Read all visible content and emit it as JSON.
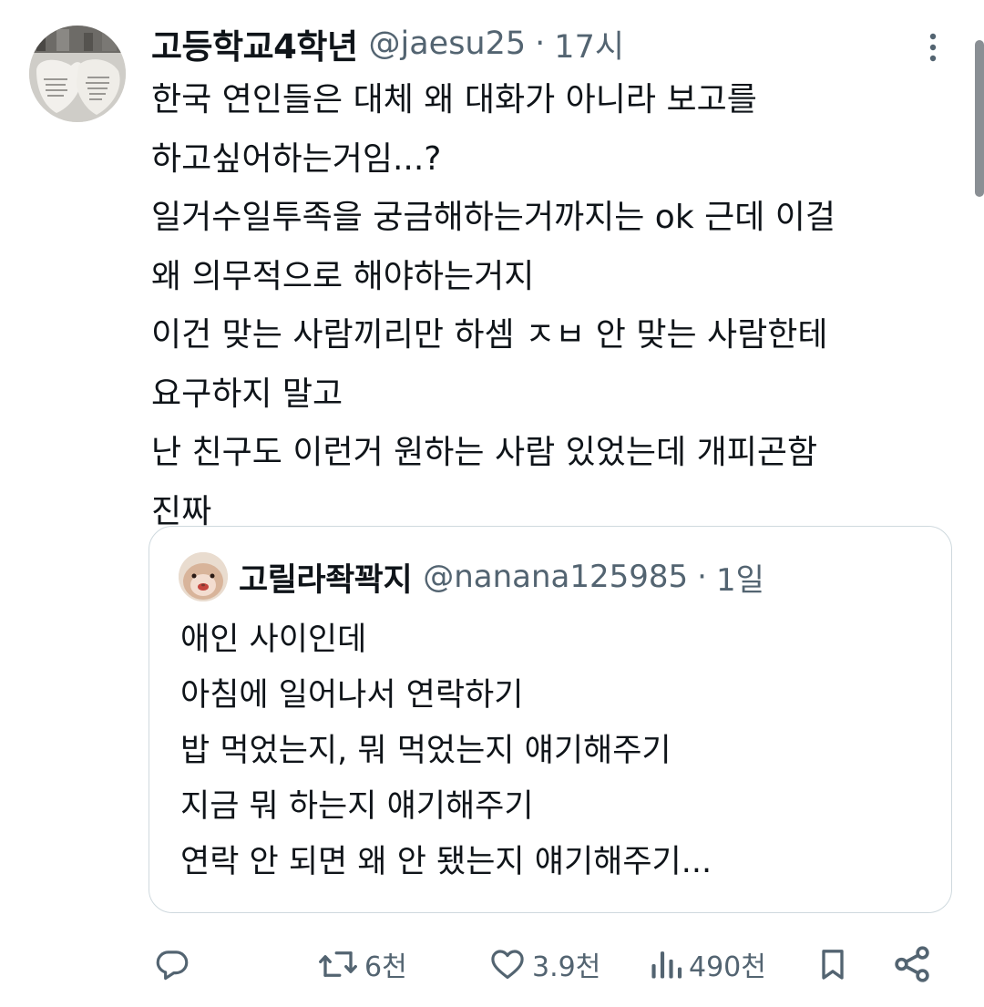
{
  "tweet": {
    "author_name": "고등학교4학년",
    "handle": "@jaesu25",
    "separator": "·",
    "time": "17시",
    "avatar_icon": "profile-photo-avatar",
    "more_icon": "vertical-ellipsis-icon",
    "lines": [
      "한국 연인들은 대체 왜 대화가 아니라 보고를",
      "하고싶어하는거임...?",
      "일거수일투족을 궁금해하는거까지는 ok 근데 이걸",
      "왜 의무적으로 해야하는거지",
      "이건 맞는 사람끼리만 하셈 ㅈㅂ 안 맞는 사람한테",
      "요구하지 말고",
      "난 친구도 이런거 원하는 사람 있었는데 개피곤함",
      "진짜"
    ]
  },
  "quote": {
    "author_name": "고릴라좍꽉지",
    "handle": "@nanana125985",
    "separator": "·",
    "time": "1일",
    "avatar_icon": "hamster-photo-avatar",
    "lines": [
      "애인 사이인데",
      "아침에 일어나서 연락하기",
      "밥 먹었는지, 뭐 먹었는지 얘기해주기",
      "지금 뭐 하는지 얘기해주기",
      "연락 안 되면 왜 안 됐는지 얘기해주기..."
    ]
  },
  "actions": {
    "reply": {
      "icon": "reply-bubble-icon",
      "count": ""
    },
    "retweet": {
      "icon": "retweet-icon",
      "count": "6천"
    },
    "like": {
      "icon": "heart-icon",
      "count": "3.9천"
    },
    "views": {
      "icon": "views-bar-chart-icon",
      "count": "490천"
    },
    "bookmark": {
      "icon": "bookmark-icon",
      "count": ""
    },
    "share": {
      "icon": "share-icon",
      "count": ""
    }
  },
  "colors": {
    "text": "#0f1419",
    "secondary": "#536471",
    "border": "#cfd9de"
  }
}
